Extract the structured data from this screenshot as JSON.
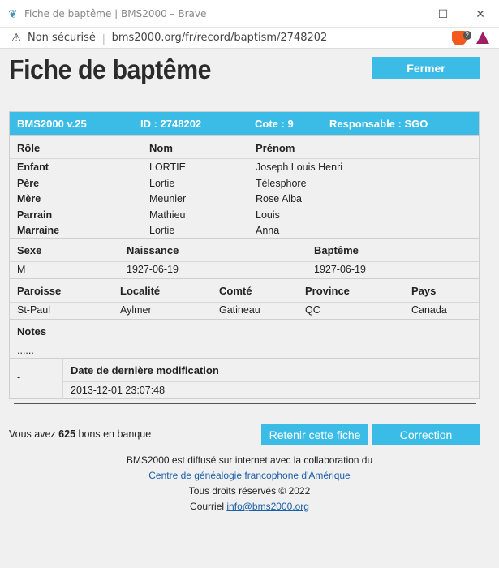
{
  "window": {
    "title": "Fiche de baptême | BMS2000 – Brave",
    "security": "Non sécurisé",
    "url": "bms2000.org/fr/record/baptism/2748202",
    "brave_badge": "2"
  },
  "page": {
    "title": "Fiche de baptême",
    "close_label": "Fermer"
  },
  "card": {
    "version": "BMS2000 v.25",
    "id": "ID : 2748202",
    "cote": "Cote : 9",
    "responsable": "Responsable : SGO",
    "people_headers": [
      "Rôle",
      "Nom",
      "Prénom"
    ],
    "people": [
      {
        "role": "Enfant",
        "nom": "LORTIE",
        "prenom": "Joseph Louis Henri"
      },
      {
        "role": "Père",
        "nom": "Lortie",
        "prenom": "Télesphore"
      },
      {
        "role": "Mère",
        "nom": "Meunier",
        "prenom": "Rose Alba"
      },
      {
        "role": "Parrain",
        "nom": "Mathieu",
        "prenom": "Louis"
      },
      {
        "role": "Marraine",
        "nom": "Lortie",
        "prenom": "Anna"
      }
    ],
    "vital_headers": [
      "Sexe",
      "Naissance",
      "Baptême"
    ],
    "vital_values": [
      "M",
      "1927-06-19",
      "1927-06-19"
    ],
    "place_headers": [
      "Paroisse",
      "Localité",
      "Comté",
      "Province",
      "Pays"
    ],
    "place_values": [
      "St-Paul",
      "Aylmer",
      "Gatineau",
      "QC",
      "Canada"
    ],
    "notes_header": "Notes",
    "notes_value": "......",
    "dash": "-",
    "modif_header": "Date de dernière modification",
    "modif_value": "2013-12-01 23:07:48"
  },
  "bank": {
    "prefix": "Vous avez",
    "count": "625",
    "suffix": "bons en banque"
  },
  "actions": {
    "keep_label": "Retenir cette fiche",
    "correction_label": "Correction"
  },
  "footer": {
    "line1": "BMS2000 est diffusé sur internet avec la collaboration du",
    "link1": "Centre de généalogie francophone d'Amérique",
    "line3": "Tous droits réservés © 2022",
    "contact_prefix": "Courriel",
    "email": "info@bms2000.org"
  }
}
